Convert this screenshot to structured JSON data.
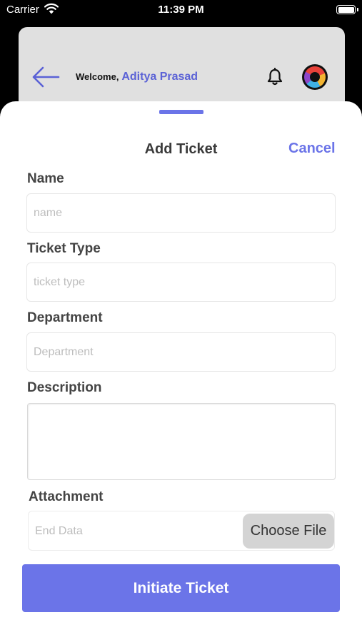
{
  "status_bar": {
    "carrier": "Carrier",
    "time": "11:39 PM",
    "icons": [
      "wifi-icon",
      "battery-icon"
    ]
  },
  "header": {
    "welcome_prefix": "Welcome,",
    "user_name": "Aditya Prasad",
    "icons": [
      "back-arrow-icon",
      "bell-icon",
      "avatar"
    ]
  },
  "sheet": {
    "title": "Add Ticket",
    "cancel_label": "Cancel"
  },
  "form": {
    "name": {
      "label": "Name",
      "placeholder": "name",
      "value": ""
    },
    "ticket_type": {
      "label": "Ticket Type",
      "placeholder": "ticket type",
      "value": ""
    },
    "department": {
      "label": "Department",
      "placeholder": "Department",
      "value": ""
    },
    "description": {
      "label": "Description",
      "value": ""
    },
    "attachment": {
      "label": "Attachment",
      "placeholder": "End Data",
      "button_label": "Choose File"
    },
    "submit_label": "Initiate Ticket"
  },
  "colors": {
    "accent": "#6b74e8",
    "username": "#5b62d6",
    "header_bg": "#e0e0e0",
    "label": "#444444",
    "placeholder": "#bdbdbd"
  }
}
